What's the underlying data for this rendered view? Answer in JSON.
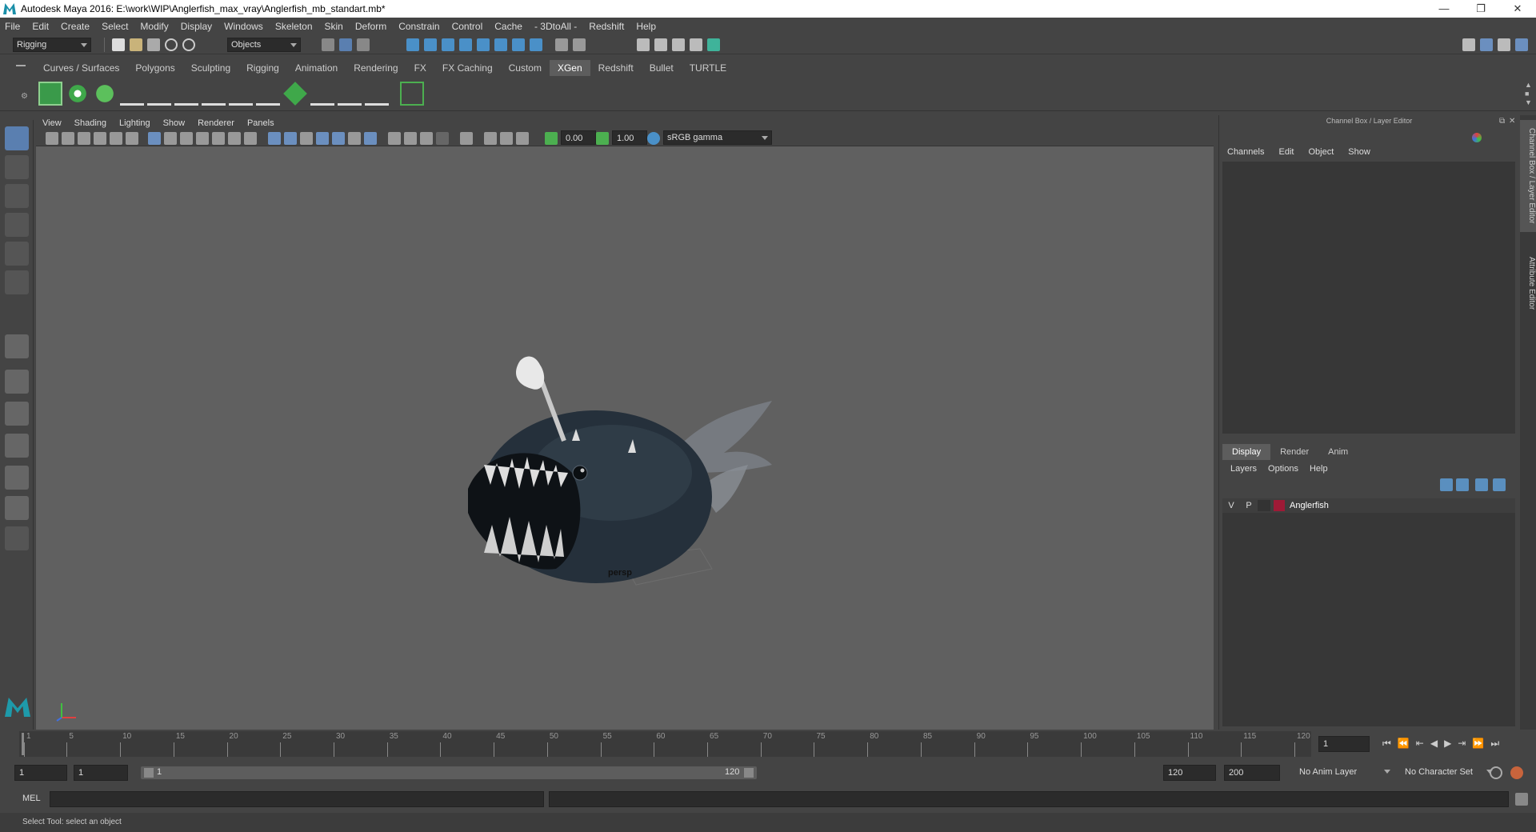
{
  "window": {
    "title": "Autodesk Maya 2016: E:\\work\\WIP\\Anglerfish_max_vray\\Anglerfish_mb_standart.mb*",
    "minimize": "—",
    "restore": "❐",
    "close": "✕"
  },
  "menubar": [
    "File",
    "Edit",
    "Create",
    "Select",
    "Modify",
    "Display",
    "Windows",
    "Skeleton",
    "Skin",
    "Deform",
    "Constrain",
    "Control",
    "Cache",
    "- 3DtoAll -",
    "Redshift",
    "Help"
  ],
  "status_line": {
    "menu_set": "Rigging",
    "selection_mode": "Objects"
  },
  "shelf_tabs": [
    {
      "label": "Curves / Surfaces",
      "active": false
    },
    {
      "label": "Polygons",
      "active": false
    },
    {
      "label": "Sculpting",
      "active": false
    },
    {
      "label": "Rigging",
      "active": false
    },
    {
      "label": "Animation",
      "active": false
    },
    {
      "label": "Rendering",
      "active": false
    },
    {
      "label": "FX",
      "active": false
    },
    {
      "label": "FX Caching",
      "active": false
    },
    {
      "label": "Custom",
      "active": false
    },
    {
      "label": "XGen",
      "active": true
    },
    {
      "label": "Redshift",
      "active": false
    },
    {
      "label": "Bullet",
      "active": false
    },
    {
      "label": "TURTLE",
      "active": false
    }
  ],
  "viewport": {
    "menus": [
      "View",
      "Shading",
      "Lighting",
      "Show",
      "Renderer",
      "Panels"
    ],
    "exposure": "0.00",
    "gamma": "1.00",
    "color_space": "sRGB gamma",
    "camera_label": "persp"
  },
  "right_panel": {
    "title": "Channel Box / Layer Editor",
    "channel_menus": [
      "Channels",
      "Edit",
      "Object",
      "Show"
    ],
    "layer_tabs": [
      {
        "label": "Display",
        "active": true
      },
      {
        "label": "Render",
        "active": false
      },
      {
        "label": "Anim",
        "active": false
      }
    ],
    "layer_menus": [
      "Layers",
      "Options",
      "Help"
    ],
    "layers": [
      {
        "visible": "V",
        "playback": "P",
        "color": "#9e1a36",
        "name": "Anglerfish"
      }
    ],
    "side_tabs": [
      "Channel Box / Layer Editor",
      "Attribute Editor"
    ]
  },
  "time_slider": {
    "ticks": [
      "1",
      "5",
      "10",
      "15",
      "20",
      "25",
      "30",
      "35",
      "40",
      "45",
      "50",
      "55",
      "60",
      "65",
      "70",
      "75",
      "80",
      "85",
      "90",
      "95",
      "100",
      "105",
      "110",
      "115",
      "120"
    ],
    "current_frame": "1"
  },
  "range_slider": {
    "start": "1",
    "playback_start": "1",
    "range_start_label": "1",
    "range_end_label": "120",
    "playback_end": "120",
    "end": "200",
    "anim_layer": "No Anim Layer",
    "character_set": "No Character Set"
  },
  "command_line": {
    "label": "MEL"
  },
  "help_line": "Select Tool: select an object",
  "colors": {
    "accent_green": "#4caf50",
    "accent_blue": "#4a90c8",
    "layer_color": "#9e1a36"
  }
}
